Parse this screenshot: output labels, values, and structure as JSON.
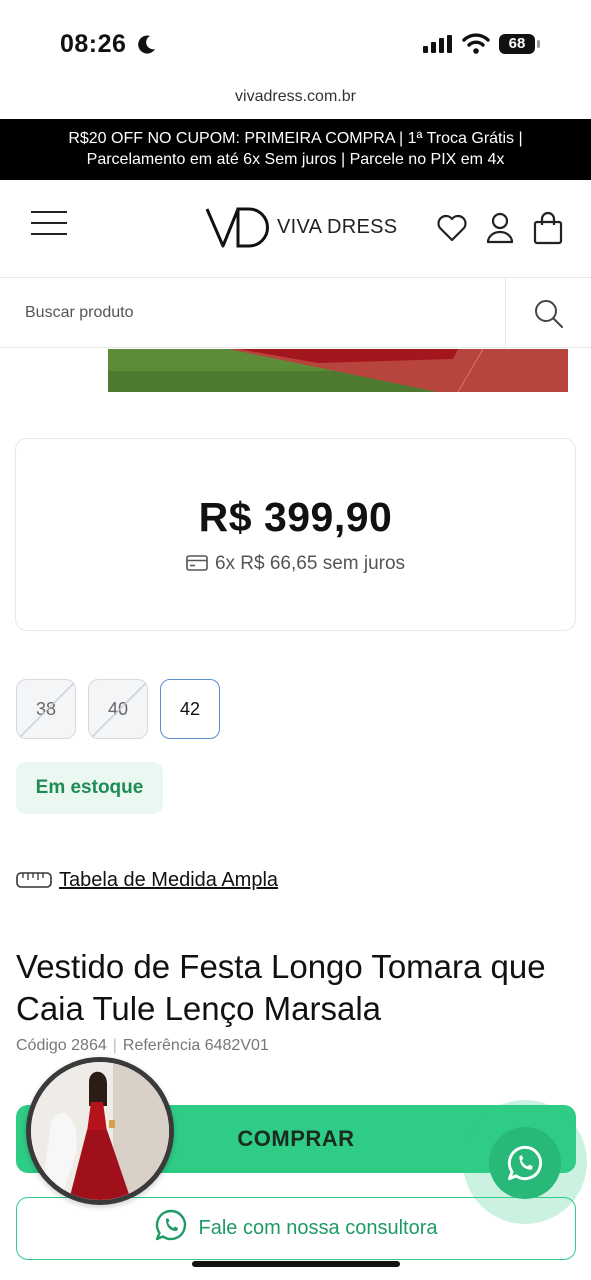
{
  "status_bar": {
    "time": "08:26",
    "battery": "68"
  },
  "browser": {
    "url": "vivadress.com.br"
  },
  "promo": {
    "line1": "R$20 OFF NO CUPOM: PRIMEIRA COMPRA | 1ª Troca Grátis |",
    "line2": "Parcelamento em até 6x Sem juros | Parcele no PIX em 4x"
  },
  "header": {
    "logo_text": "VIVA DRESS"
  },
  "search": {
    "placeholder": "Buscar produto"
  },
  "price_card": {
    "price": "R$ 399,90",
    "installments": "6x R$ 66,65 sem juros"
  },
  "sizes": [
    {
      "label": "38",
      "available": false
    },
    {
      "label": "40",
      "available": false
    },
    {
      "label": "42",
      "available": true,
      "selected": true
    }
  ],
  "stock": {
    "label": "Em estoque"
  },
  "size_chart": {
    "label": "Tabela de Medida Ampla"
  },
  "product": {
    "title": "Vestido de Festa Longo Tomara que Caia Tule Lenço Marsala",
    "code": "Código 2864",
    "reference": "Referência 6482V01"
  },
  "actions": {
    "buy_label": "COMPRAR",
    "consult_label": "Fale com nossa consultora"
  },
  "colors": {
    "accent_green": "#2ecc85",
    "stock_green": "#1f8c55",
    "banner_bg": "#000000",
    "dress_red": "#b5121b"
  },
  "icons": [
    "moon-icon",
    "signal-icon",
    "wifi-icon",
    "battery-icon",
    "menu-icon",
    "heart-icon",
    "user-icon",
    "bag-icon",
    "search-icon",
    "card-icon",
    "tape-measure-icon",
    "whatsapp-icon"
  ]
}
